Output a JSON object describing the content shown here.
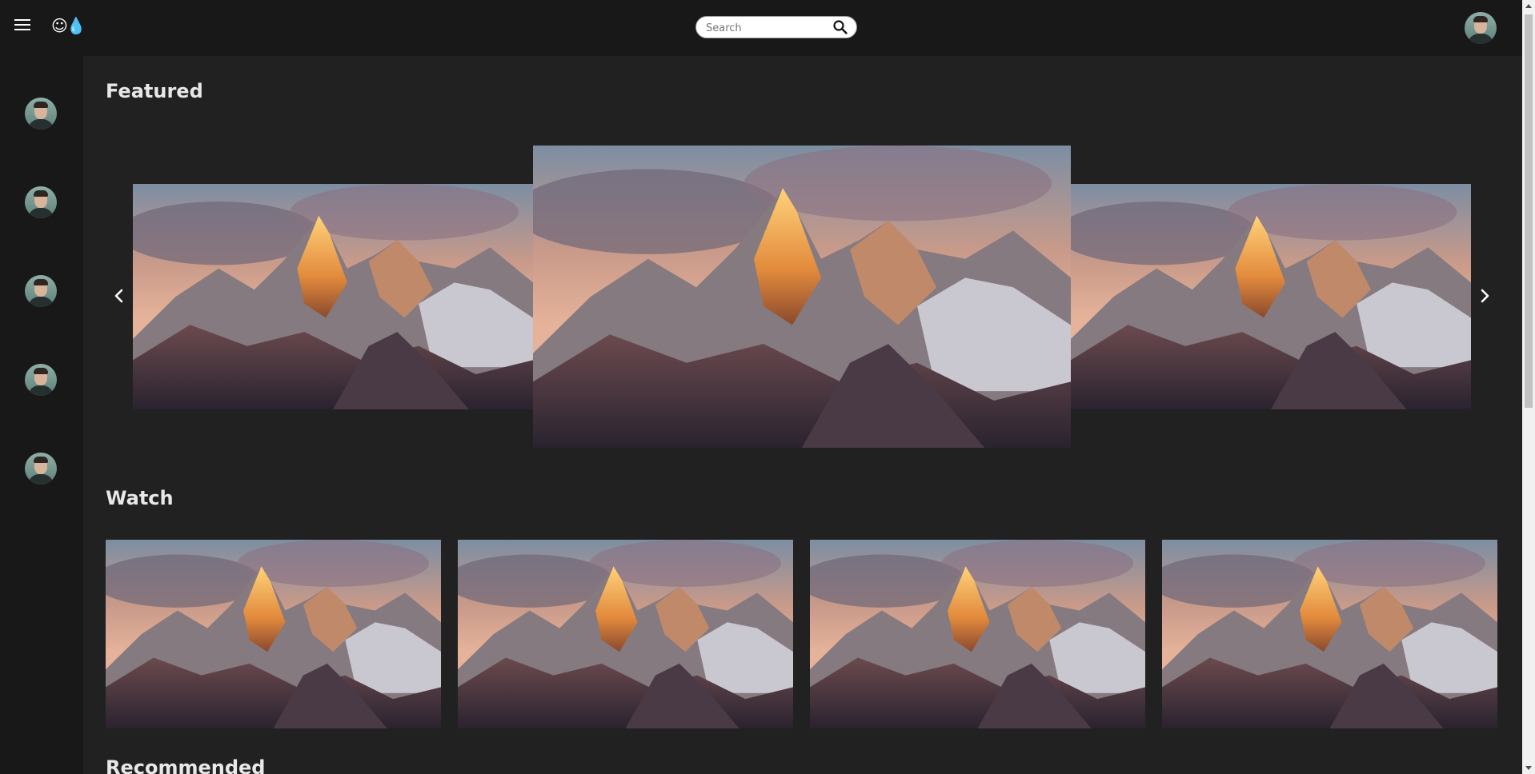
{
  "header": {
    "search_placeholder": "Search",
    "logo_glyphs": "☺💧"
  },
  "sections": {
    "featured_title": "Featured",
    "watch_title": "Watch",
    "recommended_title": "Recommended"
  },
  "featured": {
    "items": [
      "mountain-image",
      "mountain-image",
      "mountain-image"
    ]
  },
  "watch": {
    "items": [
      "mountain-image",
      "mountain-image",
      "mountain-image",
      "mountain-image"
    ]
  },
  "sidebar": {
    "avatar_count": 5
  },
  "icons": {
    "menu": "menu-icon",
    "search": "search-icon",
    "prev": "chevron-left-icon",
    "next": "chevron-right-icon"
  },
  "colors": {
    "background": "#212121",
    "chrome": "#181818",
    "text": "#e8e8e8"
  }
}
